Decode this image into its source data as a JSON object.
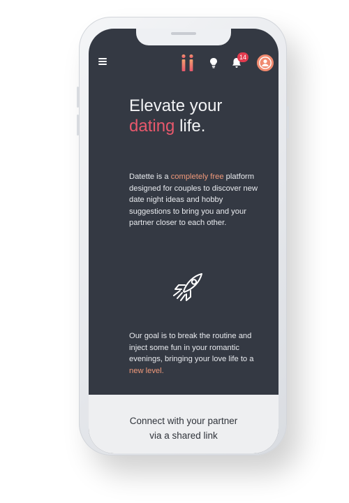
{
  "header": {
    "icons": {
      "menu": "hamburger-menu-icon",
      "logo": "ii-logo-icon",
      "ideas": "lightbulb-icon",
      "notifications": "bell-icon",
      "profile": "user-avatar-icon"
    },
    "notification_count": "14"
  },
  "hero": {
    "title_part1": "Elevate your",
    "title_accent": "dating",
    "title_part2": "life."
  },
  "intro": {
    "text_before": "Datette is a ",
    "highlight": "completely free",
    "text_after": " platform designed for couples to discover new date night ideas and hobby suggestions to bring you and your partner closer to each other."
  },
  "illustration": {
    "icon": "rocket-icon"
  },
  "goal": {
    "text_before": "Our goal is to break the routine and inject some fun in your romantic evenings, bringing your love life to a ",
    "highlight": "new level."
  },
  "footer": {
    "line1": "Connect with your partner",
    "line2": "via a shared link"
  },
  "colors": {
    "screen_background": "#343943",
    "accent_red": "#e8586c",
    "accent_peach": "#f0997a",
    "badge_red": "#e23b4e",
    "avatar_orange": "#f08a6f",
    "footer_background": "#eeeff1"
  }
}
